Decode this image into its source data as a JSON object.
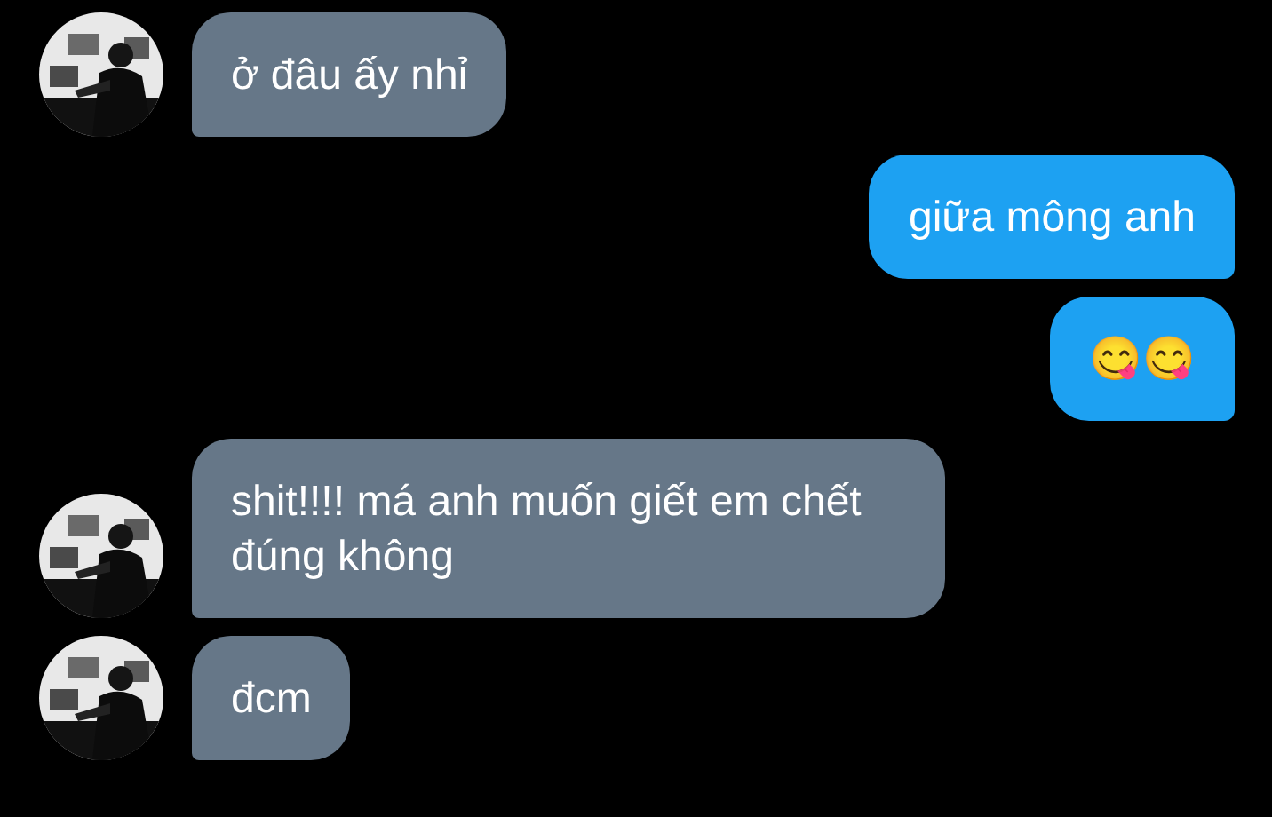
{
  "messages": [
    {
      "kind": "incoming",
      "text": "ở đâu ấy nhỉ",
      "avatar": true
    },
    {
      "kind": "outgoing",
      "text": "giữa mông anh"
    },
    {
      "kind": "outgoing",
      "text": "😋😋"
    },
    {
      "kind": "incoming",
      "text": "shit!!!! má anh muốn giết em chết đúng không",
      "avatar": true
    },
    {
      "kind": "incoming",
      "text": "đcm",
      "avatar": true
    }
  ]
}
